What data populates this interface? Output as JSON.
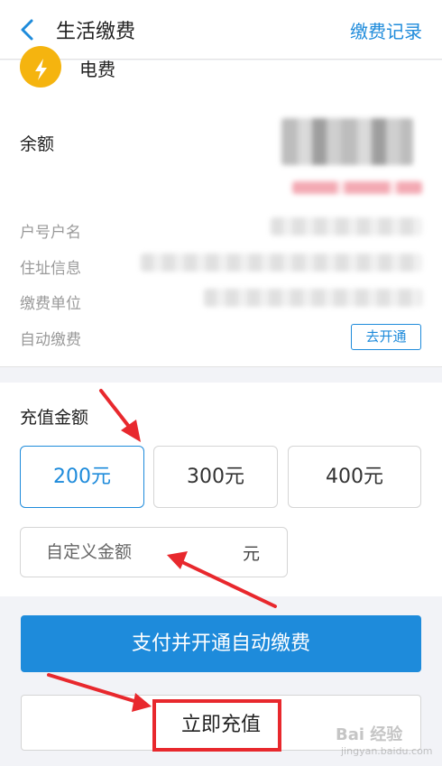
{
  "header": {
    "title": "生活缴费",
    "records_link": "缴费记录"
  },
  "account": {
    "service_name": "电费",
    "balance_label": "余额",
    "rows": [
      {
        "label": "户号户名"
      },
      {
        "label": "住址信息"
      },
      {
        "label": "缴费单位"
      },
      {
        "label": "自动缴费"
      }
    ],
    "auto_pay_button": "去开通"
  },
  "recharge": {
    "title": "充值金额",
    "options": [
      "200元",
      "300元",
      "400元"
    ],
    "selected_option": "200元",
    "custom_placeholder": "自定义金额",
    "custom_unit": "元"
  },
  "actions": {
    "pay_and_auto": "支付并开通自动缴费",
    "recharge_now": "立即充值"
  },
  "watermark": {
    "text": "Bai 经验",
    "sub": "jingyan.baidu.com"
  },
  "colors": {
    "accent": "#1e8bdb",
    "highlight": "#e8282d",
    "logo": "#f5b40f"
  }
}
